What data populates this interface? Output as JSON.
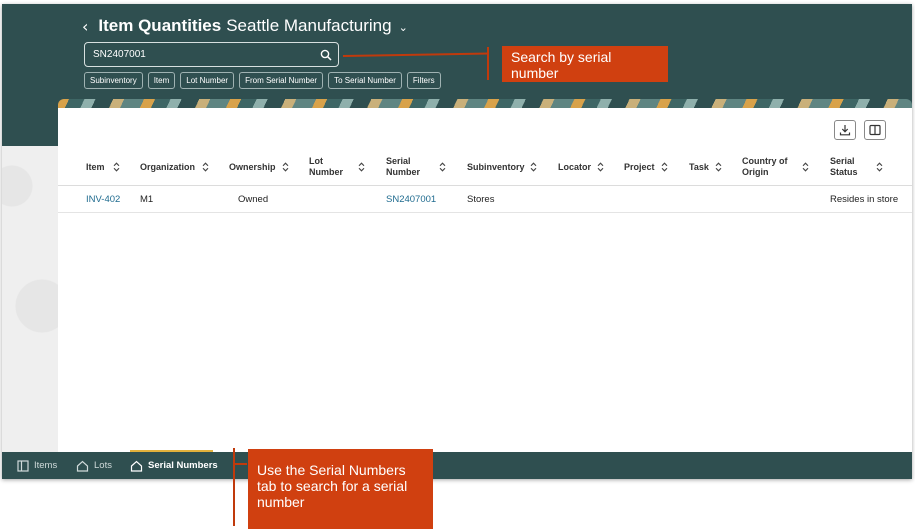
{
  "header": {
    "back_icon": "chevron-left-icon",
    "title": "Item Quantities",
    "organization": "Seattle Manufacturing",
    "org_switch_icon": "chevron-down-icon"
  },
  "search": {
    "value": "SN2407001",
    "icon": "search-icon"
  },
  "filter_chips": [
    "Subinventory",
    "Item",
    "Lot Number",
    "From Serial Number",
    "To Serial Number",
    "Filters"
  ],
  "toolbar": {
    "download_icon": "download-icon",
    "columns_icon": "columns-icon"
  },
  "table": {
    "columns": [
      {
        "line1": "Item",
        "line2": ""
      },
      {
        "line1": "Organization",
        "line2": ""
      },
      {
        "line1": "Ownership",
        "line2": ""
      },
      {
        "line1": "Lot",
        "line2": "Number"
      },
      {
        "line1": "Serial",
        "line2": "Number"
      },
      {
        "line1": "Subinventory",
        "line2": ""
      },
      {
        "line1": "Locator",
        "line2": ""
      },
      {
        "line1": "Project",
        "line2": ""
      },
      {
        "line1": "Task",
        "line2": ""
      },
      {
        "line1": "Country of",
        "line2": "Origin"
      },
      {
        "line1": "Serial",
        "line2": "Status"
      }
    ],
    "rows": [
      {
        "item": "INV-402",
        "organization": "M1",
        "ownership": "Owned",
        "lot_number": "",
        "serial_number": "SN2407001",
        "subinventory": "Stores",
        "locator": "",
        "project": "",
        "task": "",
        "country_of_origin": "",
        "serial_status": "Resides in store"
      }
    ]
  },
  "bottom_tabs": [
    {
      "label": "Items",
      "icon": "panel-icon",
      "active": false
    },
    {
      "label": "Lots",
      "icon": "home-icon",
      "active": false
    },
    {
      "label": "Serial Numbers",
      "icon": "home-icon",
      "active": true
    }
  ],
  "callouts": {
    "search": "Search by serial number",
    "serial_tab": "Use the Serial Numbers tab to search for a serial number"
  },
  "colors": {
    "header_bg": "#2f4f50",
    "link": "#1f6b8f",
    "callout": "#d04010",
    "active_tab_indicator": "#e2b13c"
  }
}
